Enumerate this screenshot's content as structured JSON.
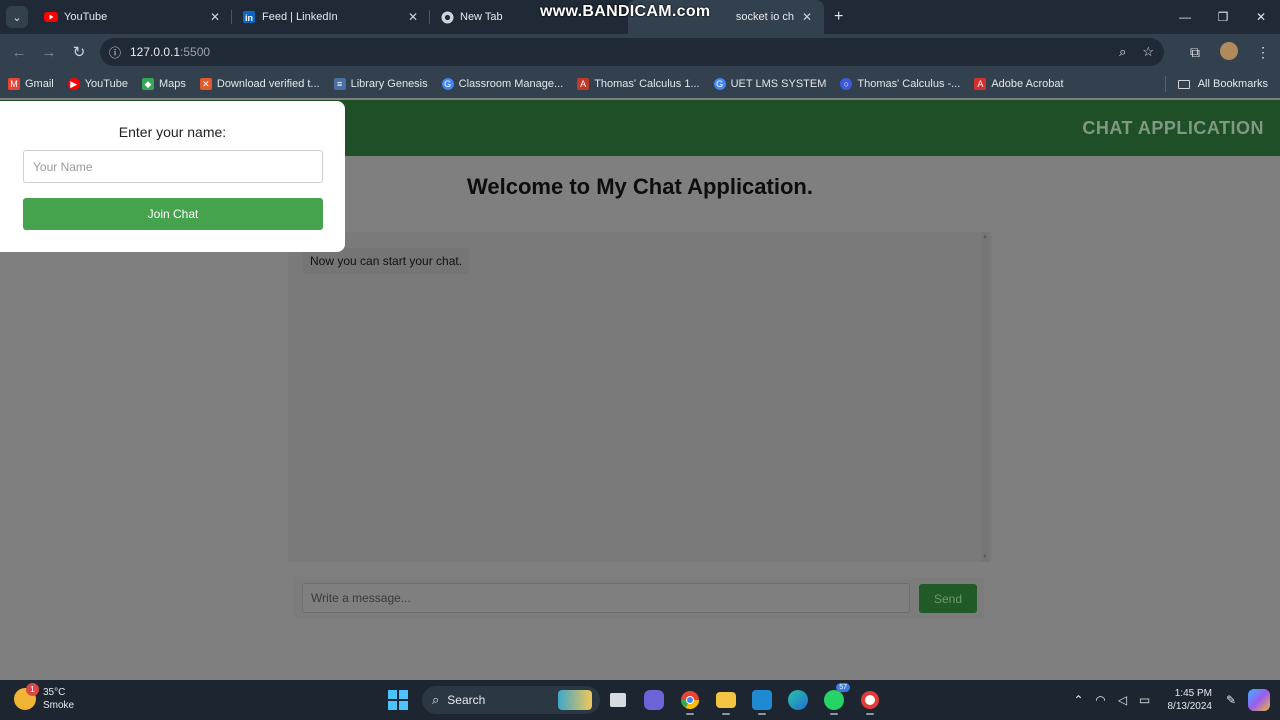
{
  "browser": {
    "tabs": [
      {
        "title": "YouTube",
        "icon": "youtube-icon"
      },
      {
        "title": "Feed | LinkedIn",
        "icon": "linkedin-icon"
      },
      {
        "title": "New Tab",
        "icon": "chrome-icon"
      },
      {
        "title": "socket io ch",
        "icon": "page-icon"
      }
    ],
    "watermark": "www.BANDICAM.com",
    "url_host": "127.0.0.1",
    "url_port": ":5500",
    "bookmarks": [
      {
        "label": "Gmail",
        "color": "#ea4335"
      },
      {
        "label": "YouTube",
        "color": "#ff0000"
      },
      {
        "label": "Maps",
        "color": "#34a853"
      },
      {
        "label": "Download verified t...",
        "color": "#e25a2b"
      },
      {
        "label": "Library Genesis",
        "color": "#4a6fa5"
      },
      {
        "label": "Classroom Manage...",
        "color": "#4285f4"
      },
      {
        "label": "Thomas' Calculus 1...",
        "color": "#c0392b"
      },
      {
        "label": "UET LMS SYSTEM",
        "color": "#4285f4"
      },
      {
        "label": "Thomas' Calculus -...",
        "color": "#3b5bdb"
      },
      {
        "label": "Adobe Acrobat",
        "color": "#d32f2f"
      }
    ],
    "all_bookmarks": "All Bookmarks"
  },
  "app": {
    "header_title": "CHAT APPLICATION",
    "welcome": "Welcome to My Chat Application.",
    "messages": [
      "Now you can start your chat."
    ],
    "message_placeholder": "Write a message...",
    "send_label": "Send"
  },
  "modal": {
    "label": "Enter your name:",
    "name_placeholder": "Your Name",
    "join_label": "Join Chat"
  },
  "taskbar": {
    "temperature": "35°C",
    "weather": "Smoke",
    "weather_badge": "1",
    "search": "Search",
    "whatsapp_badge": "57",
    "time": "1:45 PM",
    "date": "8/13/2024"
  },
  "colors": {
    "header_green": "#1f4f26",
    "join_green": "#45a34d"
  }
}
